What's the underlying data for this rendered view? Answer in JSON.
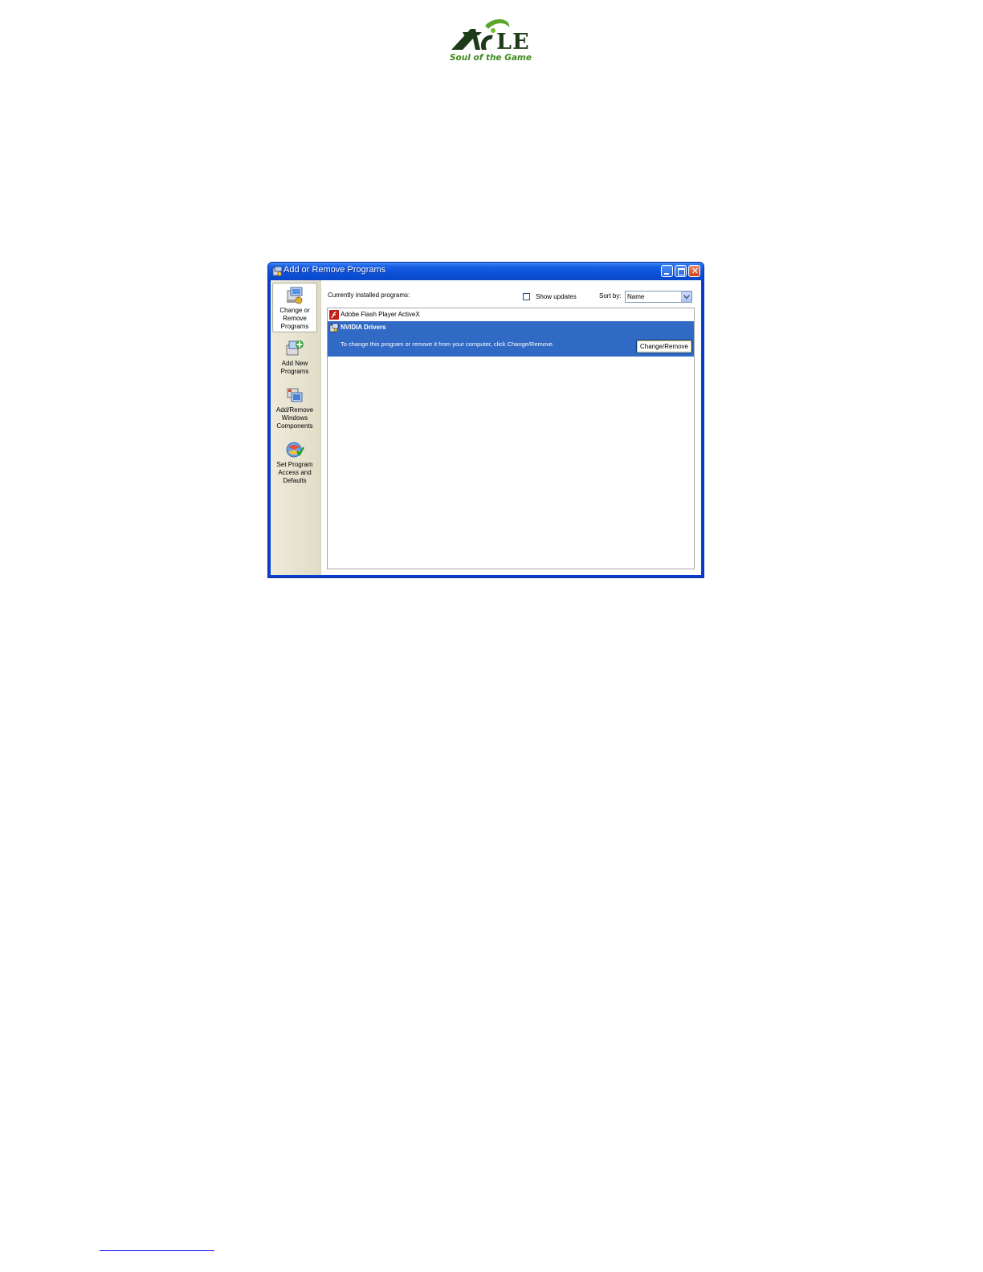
{
  "logo": {
    "letters": "LE",
    "tagline": "Soul of the Game",
    "colors": {
      "dark": "#1f3a1a",
      "green": "#3e8b1c"
    }
  },
  "window": {
    "title": "Add or Remove Programs",
    "title_icon": "add-remove-programs-icon",
    "controls": {
      "minimize": "minimize-icon",
      "maximize": "maximize-icon",
      "close": "close-icon",
      "close_glyph": "✕"
    }
  },
  "sidebar": {
    "items": [
      {
        "label": "Change or\nRemove\nPrograms",
        "icon": "change-remove-programs-icon",
        "active": true
      },
      {
        "label": "Add New\nPrograms",
        "icon": "add-new-programs-icon",
        "active": false
      },
      {
        "label": "Add/Remove\nWindows\nComponents",
        "icon": "windows-components-icon",
        "active": false
      },
      {
        "label": "Set Program\nAccess and\nDefaults",
        "icon": "program-defaults-icon",
        "active": false
      }
    ]
  },
  "main": {
    "installed_label": "Currently installed programs:",
    "show_updates_label": "Show updates",
    "show_updates_checked": false,
    "sort_by_label": "Sort by:",
    "sort_by_value": "Name",
    "programs": [
      {
        "name": "Adobe Flash Player ActiveX",
        "icon": "flash-player-icon",
        "selected": false
      },
      {
        "name": "NVIDIA Drivers",
        "icon": "nvidia-installer-icon",
        "selected": true,
        "hint": "To change this program or remove it from your computer, click Change/Remove.",
        "action_label": "Change/Remove"
      }
    ]
  },
  "colors": {
    "titlebar": "#0b50d8",
    "selection": "#316ac5",
    "sidebar": "#ece9d8"
  }
}
